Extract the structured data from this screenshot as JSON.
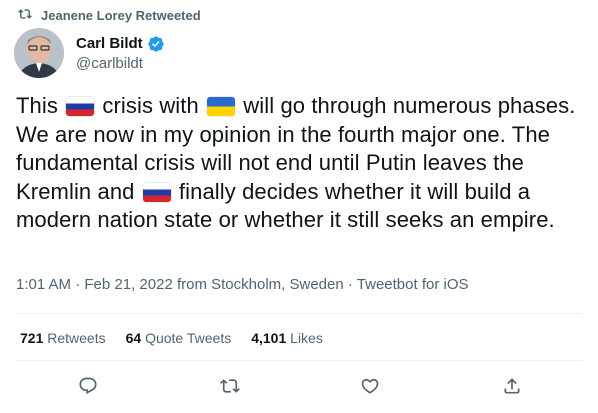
{
  "retweet_context": {
    "text": "Jeanene Lorey Retweeted",
    "icon": "retweet-icon"
  },
  "author": {
    "display_name": "Carl Bildt",
    "handle": "@carlbildt",
    "verified": true
  },
  "tweet": {
    "seg1": "This ",
    "seg2": " crisis with ",
    "seg3": " will go through numerous phases. We are now in my opinion in the fourth major one. The fundamental crisis will not end until Putin leaves the Kremlin and ",
    "seg4": " finally decides whether it will build a modern nation state or whether it still seeks an empire.",
    "flags": [
      "russia-flag",
      "ukraine-flag",
      "russia-flag"
    ]
  },
  "meta": {
    "time": "1:01 AM",
    "date": "Feb 21, 2022",
    "location": "from Stockholm, Sweden",
    "client": "Tweetbot for iOS",
    "separator": " · "
  },
  "stats": {
    "retweets_count": "721",
    "retweets_label": "Retweets",
    "quotes_count": "64",
    "quotes_label": "Quote Tweets",
    "likes_count": "4,101",
    "likes_label": "Likes"
  },
  "actions": [
    "reply-icon",
    "retweet-icon",
    "like-icon",
    "share-icon"
  ],
  "colors": {
    "text": "#0f1419",
    "secondary": "#536471",
    "verified": "#1d9bf0",
    "divider": "#eff3f4"
  }
}
